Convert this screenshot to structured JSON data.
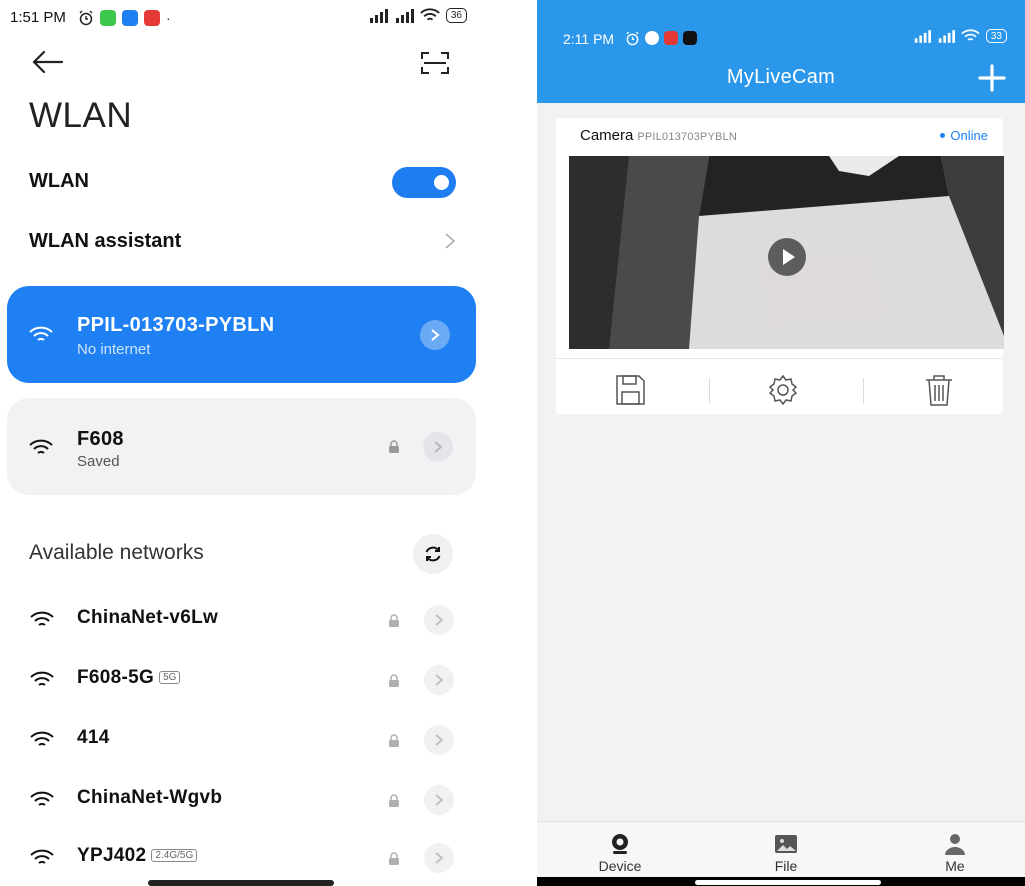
{
  "left_phone": {
    "status_bar": {
      "time": "1:51 PM",
      "battery": "36"
    },
    "title": "WLAN",
    "wlan_toggle_label": "WLAN",
    "wlan_enabled": true,
    "assistant_label": "WLAN assistant",
    "connected": {
      "ssid": "PPIL-013703-PYBLN",
      "status": "No internet"
    },
    "saved": {
      "ssid": "F608",
      "status": "Saved"
    },
    "available_label": "Available networks",
    "available": [
      {
        "ssid": "ChinaNet-v6Lw",
        "band": ""
      },
      {
        "ssid": "F608-5G",
        "band": "5G"
      },
      {
        "ssid": "414",
        "band": ""
      },
      {
        "ssid": "ChinaNet-Wgvb",
        "band": ""
      },
      {
        "ssid": "YPJ402",
        "band": "2.4G/5G"
      }
    ]
  },
  "right_phone": {
    "status_bar": {
      "time": "2:11 PM",
      "battery": "33"
    },
    "app_title": "MyLiveCam",
    "camera": {
      "name": "Camera",
      "id": "PPIL013703PYBLN",
      "status": "Online"
    },
    "tabs": [
      {
        "label": "Device",
        "icon": "webcam-icon"
      },
      {
        "label": "File",
        "icon": "image-icon"
      },
      {
        "label": "Me",
        "icon": "person-icon"
      }
    ],
    "colors": {
      "header": "#2b97ea",
      "accent": "#1e80f2"
    }
  }
}
